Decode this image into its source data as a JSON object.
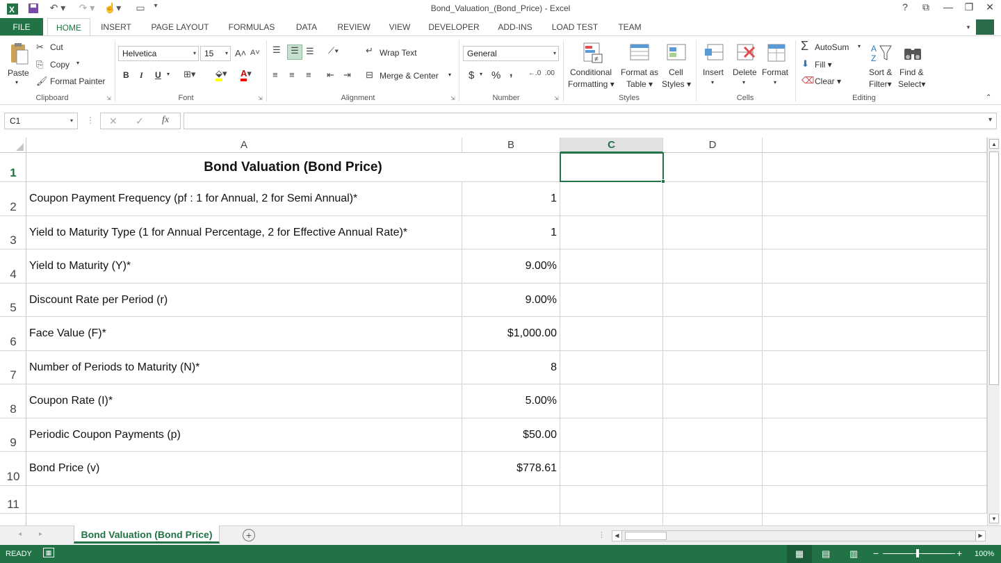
{
  "window": {
    "title": "Bond_Valuation_(Bond_Price) - Excel",
    "help": "?",
    "controls": [
      "restore-ribbon",
      "minimize",
      "maximize",
      "close"
    ]
  },
  "tabs": {
    "file": "FILE",
    "items": [
      "HOME",
      "INSERT",
      "PAGE LAYOUT",
      "FORMULAS",
      "DATA",
      "REVIEW",
      "VIEW",
      "DEVELOPER",
      "ADD-INS",
      "LOAD TEST",
      "TEAM"
    ],
    "active": "HOME"
  },
  "ribbon": {
    "clipboard": {
      "label": "Clipboard",
      "paste": "Paste",
      "cut": "Cut",
      "copy": "Copy",
      "format_painter": "Format Painter"
    },
    "font": {
      "label": "Font",
      "family": "Helvetica",
      "size": "15",
      "bold": "B",
      "italic": "I",
      "underline": "U"
    },
    "alignment": {
      "label": "Alignment",
      "wrap_text": "Wrap Text",
      "merge_center": "Merge & Center"
    },
    "number": {
      "label": "Number",
      "format": "General",
      "currency": "$",
      "percent": "%",
      "comma": ","
    },
    "styles": {
      "label": "Styles",
      "conditional": [
        "Conditional",
        "Formatting"
      ],
      "format_table": [
        "Format as",
        "Table"
      ],
      "cell_styles": [
        "Cell",
        "Styles"
      ]
    },
    "cells": {
      "label": "Cells",
      "insert": "Insert",
      "delete": "Delete",
      "format": "Format"
    },
    "editing": {
      "label": "Editing",
      "autosum": "AutoSum",
      "fill": "Fill",
      "clear": "Clear",
      "sort": [
        "Sort &",
        "Filter"
      ],
      "find": [
        "Find &",
        "Select"
      ]
    }
  },
  "formula_bar": {
    "name_box": "C1",
    "fx": "fx",
    "value": ""
  },
  "sheet": {
    "columns": [
      "A",
      "B",
      "C",
      "D"
    ],
    "selected_column": "C",
    "selected_row": "1",
    "rows": [
      {
        "num": "1",
        "a": "Bond Valuation (Bond Price)",
        "b": ""
      },
      {
        "num": "2",
        "a": "Coupon Payment Frequency (pf : 1 for Annual, 2 for Semi Annual)*",
        "b": "1"
      },
      {
        "num": "3",
        "a": "Yield to Maturity Type (1 for Annual Percentage, 2 for Effective Annual Rate)*",
        "b": "1"
      },
      {
        "num": "4",
        "a": "Yield to Maturity (Y)*",
        "b": "9.00%"
      },
      {
        "num": "5",
        "a": "Discount Rate per Period (r)",
        "b": "9.00%"
      },
      {
        "num": "6",
        "a": "Face Value (F)*",
        "b": "$1,000.00"
      },
      {
        "num": "7",
        "a": "Number of Periods to Maturity (N)*",
        "b": "8"
      },
      {
        "num": "8",
        "a": "Coupon Rate (I)*",
        "b": "5.00%"
      },
      {
        "num": "9",
        "a": "Periodic Coupon Payments (p)",
        "b": "$50.00"
      },
      {
        "num": "10",
        "a": "Bond Price (v)",
        "b": "$778.61"
      },
      {
        "num": "11",
        "a": "",
        "b": ""
      }
    ]
  },
  "sheet_tabs": {
    "active": "Bond Valuation (Bond Price)",
    "add": "+"
  },
  "status": {
    "mode": "READY",
    "zoom": "100%"
  },
  "colors": {
    "accent": "#217346"
  }
}
